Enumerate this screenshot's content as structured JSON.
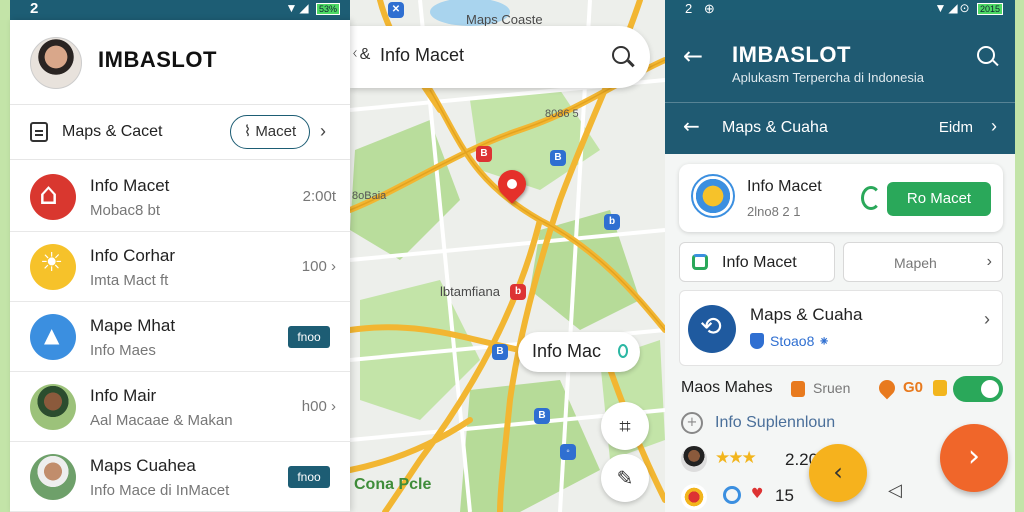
{
  "left": {
    "status": {
      "time": "2",
      "icons": "▼◢",
      "battery": "53%"
    },
    "app_title": "IMBASLOT",
    "subheader": {
      "label": "Maps & Cacet",
      "pill": "Macet"
    },
    "items": [
      {
        "title": "Info Macet",
        "subtitle": "Mobac8 bt",
        "meta": "2:00t",
        "icon": "home-icon"
      },
      {
        "title": "Info Corhar",
        "subtitle": "Imta Mact ft",
        "meta": "100",
        "icon": "sun-icon"
      },
      {
        "title": "Mape Mhat",
        "subtitle": "Info Maes",
        "tag": "fnoo",
        "icon": "navigation-icon"
      },
      {
        "title": "Info Mair",
        "subtitle": "Aal Macaae & Makan",
        "meta": "h00",
        "icon": "avatar"
      },
      {
        "title": "Maps Cuahea",
        "subtitle": "Info Mace di InMacet",
        "tag": "fnoo",
        "icon": "avatar"
      }
    ]
  },
  "map": {
    "search": {
      "prefix": "ᚲ&",
      "text": "Info Macet"
    },
    "labels": {
      "top": "Maps Coaste",
      "center": "lbtamfiana",
      "green": "Cona Pcle",
      "small1": "8086 5",
      "small2": "8oBaia",
      "small3": "b"
    },
    "bubble": "Info Mac"
  },
  "right": {
    "status": {
      "left": "2 ⊕",
      "icons": "▼◢⊙",
      "battery": "2015"
    },
    "title": "IMBASLOT",
    "subtitle": "Aplukasm Terpercha di Indonesia",
    "nav_label": "Maps & Cuaha",
    "nav_right": "Eidm",
    "card1": {
      "title": "Info Macet",
      "subtitle": "2lno8 2 1",
      "button": "Ro Macet"
    },
    "tab_a": "Info Macet",
    "tab_b": "Mapeh",
    "card2": {
      "title": "Maps & Cuaha",
      "subtitle": "Stoao8 ⁕"
    },
    "row3": {
      "title": "Maos Mahes",
      "mid": "Sruen",
      "badge": "G0"
    },
    "row4": "Info Suplennloun",
    "row5": {
      "stars": "★★★",
      "value": "2.20"
    },
    "row6": {
      "value": "15"
    }
  },
  "colors": {
    "brand": "#1d5d74",
    "green": "#2aa85a",
    "orange": "#f0662a",
    "yellow": "#f6b21d"
  }
}
